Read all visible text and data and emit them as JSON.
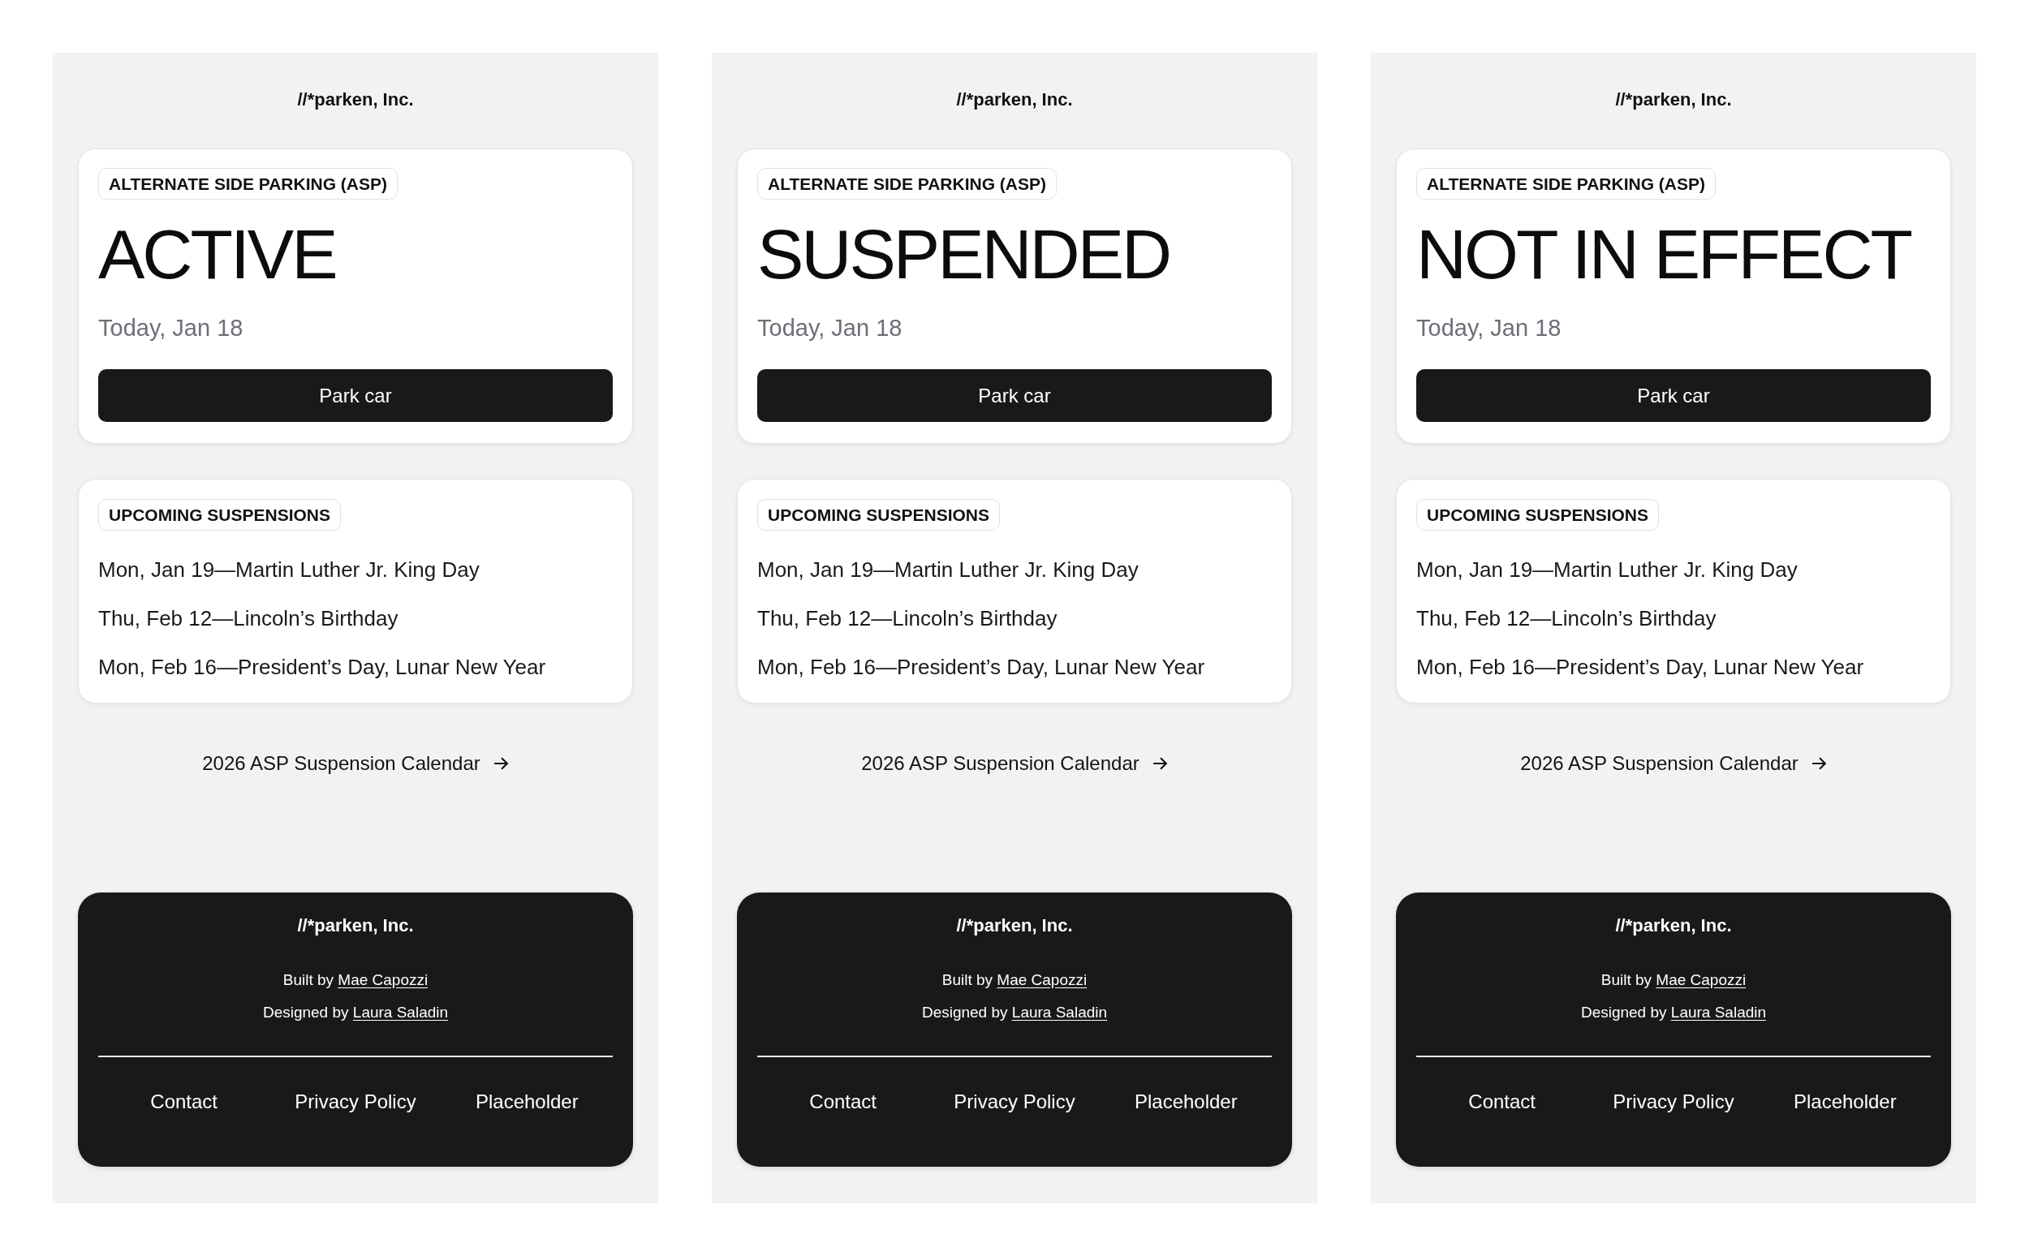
{
  "screens": [
    {
      "brand": "//*parken, Inc.",
      "status_card": {
        "tag": "ALTERNATE SIDE PARKING (ASP)",
        "status": "ACTIVE",
        "date": "Today, Jan 18",
        "button": "Park car"
      },
      "suspensions_card": {
        "tag": "UPCOMING SUSPENSIONS",
        "items": [
          "Mon, Jan 19—Martin Luther Jr. King Day",
          "Thu, Feb 12—Lincoln’s Birthday",
          "Mon, Feb 16—President’s Day, Lunar New Year"
        ]
      },
      "calendar_link": "2026 ASP Suspension Calendar",
      "footer": {
        "brand": "//*parken, Inc.",
        "credits": [
          {
            "text": "Built by",
            "link": "Mae Capozzi"
          },
          {
            "text": "Designed by",
            "link": "Laura Saladin"
          }
        ],
        "links": [
          "Contact",
          "Privacy Policy",
          "Placeholder"
        ]
      }
    },
    {
      "brand": "//*parken, Inc.",
      "status_card": {
        "tag": "ALTERNATE SIDE PARKING (ASP)",
        "status": "SUSPENDED",
        "date": "Today, Jan 18",
        "button": "Park car"
      },
      "suspensions_card": {
        "tag": "UPCOMING SUSPENSIONS",
        "items": [
          "Mon, Jan 19—Martin Luther Jr. King Day",
          "Thu, Feb 12—Lincoln’s Birthday",
          "Mon, Feb 16—President’s Day, Lunar New Year"
        ]
      },
      "calendar_link": "2026 ASP Suspension Calendar",
      "footer": {
        "brand": "//*parken, Inc.",
        "credits": [
          {
            "text": "Built by",
            "link": "Mae Capozzi"
          },
          {
            "text": "Designed by",
            "link": "Laura Saladin"
          }
        ],
        "links": [
          "Contact",
          "Privacy Policy",
          "Placeholder"
        ]
      }
    },
    {
      "brand": "//*parken, Inc.",
      "status_card": {
        "tag": "ALTERNATE SIDE PARKING (ASP)",
        "status": "NOT IN EFFECT",
        "date": "Today, Jan 18",
        "button": "Park car"
      },
      "suspensions_card": {
        "tag": "UPCOMING SUSPENSIONS",
        "items": [
          "Mon, Jan 19—Martin Luther Jr. King Day",
          "Thu, Feb 12—Lincoln’s Birthday",
          "Mon, Feb 16—President’s Day, Lunar New Year"
        ]
      },
      "calendar_link": "2026 ASP Suspension Calendar",
      "footer": {
        "brand": "//*parken, Inc.",
        "credits": [
          {
            "text": "Built by",
            "link": "Mae Capozzi"
          },
          {
            "text": "Designed by",
            "link": "Laura Saladin"
          }
        ],
        "links": [
          "Contact",
          "Privacy Policy",
          "Placeholder"
        ]
      }
    }
  ]
}
